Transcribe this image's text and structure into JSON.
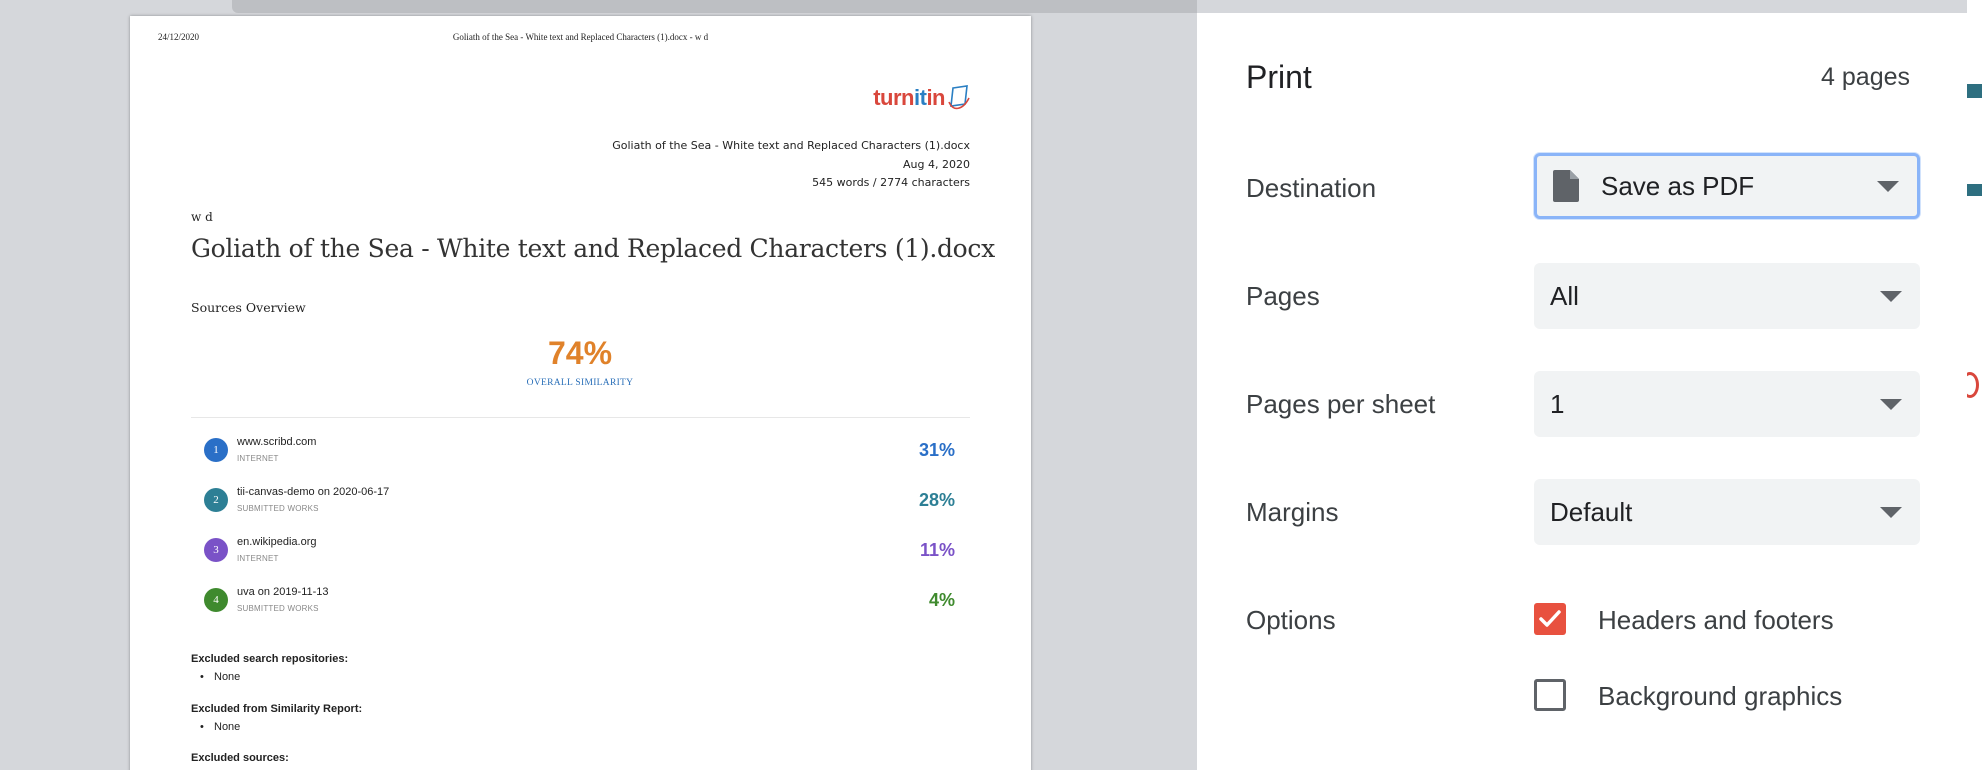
{
  "preview": {
    "header_date": "24/12/2020",
    "header_title": "Goliath of the Sea - White text and Replaced Characters (1).docx - w d",
    "logo": {
      "part1": "turn",
      "part2": "it",
      "part3": "in"
    },
    "meta": {
      "filename": "Goliath of the Sea - White text and Replaced Characters (1).docx",
      "date": "Aug 4, 2020",
      "counts": "545 words / 2774 characters"
    },
    "author": "w d",
    "doc_title": "Goliath of the Sea - White text and Replaced Characters (1).docx",
    "sources_label": "Sources Overview",
    "overall_value": "74%",
    "overall_label": "OVERALL SIMILARITY",
    "sources": [
      {
        "num": "1",
        "name": "www.scribd.com",
        "type": "INTERNET",
        "pct": "31%",
        "color": "#2a6fc7"
      },
      {
        "num": "2",
        "name": "tii-canvas-demo on 2020-06-17",
        "type": "SUBMITTED WORKS",
        "pct": "28%",
        "color": "#2d7f95"
      },
      {
        "num": "3",
        "name": "en.wikipedia.org",
        "type": "INTERNET",
        "pct": "11%",
        "color": "#7a52c7"
      },
      {
        "num": "4",
        "name": "uva on 2019-11-13",
        "type": "SUBMITTED WORKS",
        "pct": "4%",
        "color": "#3f8a2e"
      }
    ],
    "excluded": {
      "search_repos_label": "Excluded search repositories:",
      "search_repos_value": "None",
      "similarity_label": "Excluded from Similarity Report:",
      "similarity_value": "None",
      "sources_label": "Excluded sources:"
    }
  },
  "print_panel": {
    "title": "Print",
    "page_count": "4 pages",
    "destination": {
      "label": "Destination",
      "value": "Save as PDF",
      "icon": "document-icon"
    },
    "pages": {
      "label": "Pages",
      "value": "All"
    },
    "pages_per_sheet": {
      "label": "Pages per sheet",
      "value": "1"
    },
    "margins": {
      "label": "Margins",
      "value": "Default"
    },
    "options": {
      "label": "Options",
      "headers_footers": {
        "label": "Headers and footers",
        "checked": true
      },
      "background_graphics": {
        "label": "Background graphics",
        "checked": false
      }
    }
  },
  "colors": {
    "accent_checkbox": "#e8513f",
    "focus_ring": "#8ab4f8",
    "overall_similarity": "#e0822a"
  }
}
